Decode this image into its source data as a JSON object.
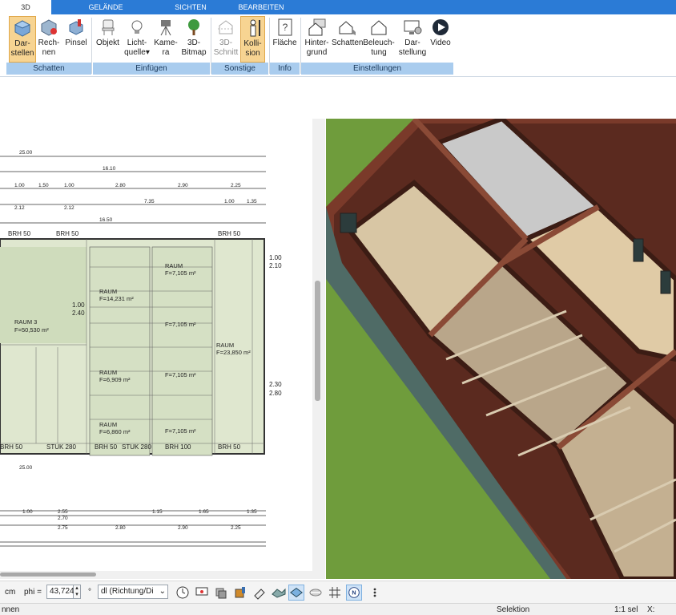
{
  "tabs": [
    "3D",
    "GELÄNDE",
    "SICHTEN",
    "BEARBEITEN"
  ],
  "ribbon": {
    "buttons": [
      {
        "l1": "Dar-",
        "l2": "stellen"
      },
      {
        "l1": "Rech-",
        "l2": "nen"
      },
      {
        "l1": "Pinsel",
        "l2": ""
      },
      {
        "l1": "Objekt",
        "l2": ""
      },
      {
        "l1": "Licht-",
        "l2": "quelle"
      },
      {
        "l1": "Kame-",
        "l2": "ra"
      },
      {
        "l1": "3D-",
        "l2": "Bitmap"
      },
      {
        "l1": "3D-",
        "l2": "Schnitt"
      },
      {
        "l1": "Kolli-",
        "l2": "sion"
      },
      {
        "l1": "Fläche",
        "l2": ""
      },
      {
        "l1": "Hinter-",
        "l2": "grund"
      },
      {
        "l1": "Schatten",
        "l2": ""
      },
      {
        "l1": "Beleuch-",
        "l2": "tung"
      },
      {
        "l1": "Dar-",
        "l2": "stellung"
      },
      {
        "l1": "Video",
        "l2": ""
      }
    ],
    "groups": [
      "Schatten",
      "Einfügen",
      "Sonstige",
      "Info",
      "Einstellungen"
    ]
  },
  "plan": {
    "dims_top": [
      "25.00",
      "16.10",
      "1.00",
      "1.50",
      "1.00",
      "7.35",
      "2.80",
      "2.90",
      "2.25",
      "2.12",
      "2.12",
      "1.00",
      "1.35",
      "16.50"
    ],
    "brh": [
      "BRH 50",
      "BRH 50",
      "BRH 50",
      "BRH 50",
      "BRH 50",
      "STUK 280",
      "BRH 50",
      "STUK 280",
      "BRH 100",
      "BRH 50"
    ],
    "rooms": [
      {
        "name": "RAUM 3",
        "area": "F=50,530 m²"
      },
      {
        "name": "RAUM",
        "area": "F=14,231 m²"
      },
      {
        "name": "RAUM",
        "area": "F=7,105 m²"
      },
      {
        "name": "RAUM",
        "area": "F=7,105 m²"
      },
      {
        "name": "RAUM",
        "area": "F=7,105 m²"
      },
      {
        "name": "RAUM",
        "area": "F=6,909 m²"
      },
      {
        "name": "RAUM",
        "area": "F=6,860 m²"
      },
      {
        "name": "RAUM",
        "area": "F=7,105 m²"
      },
      {
        "name": "RAUM",
        "area": "F=23,850 m²"
      }
    ],
    "openings": [
      "1.00",
      "2.40",
      "1.00",
      "2.10",
      "2.30",
      "2.80"
    ],
    "dims_bottom": [
      "25.00",
      "2.55",
      "2.70",
      "2.75",
      "2.80",
      "2.90",
      "2.25",
      "1.00",
      "1.15",
      "1.65",
      "1.35"
    ]
  },
  "toolbar": {
    "unit": "cm",
    "phi_label": "phi =",
    "phi_value": "43,724",
    "degree": "°",
    "dl_value": "dl (Richtung/Di"
  },
  "status": {
    "left": "nnen",
    "mode": "Selektion",
    "scale": "1:1 sel",
    "x_label": "X:"
  }
}
